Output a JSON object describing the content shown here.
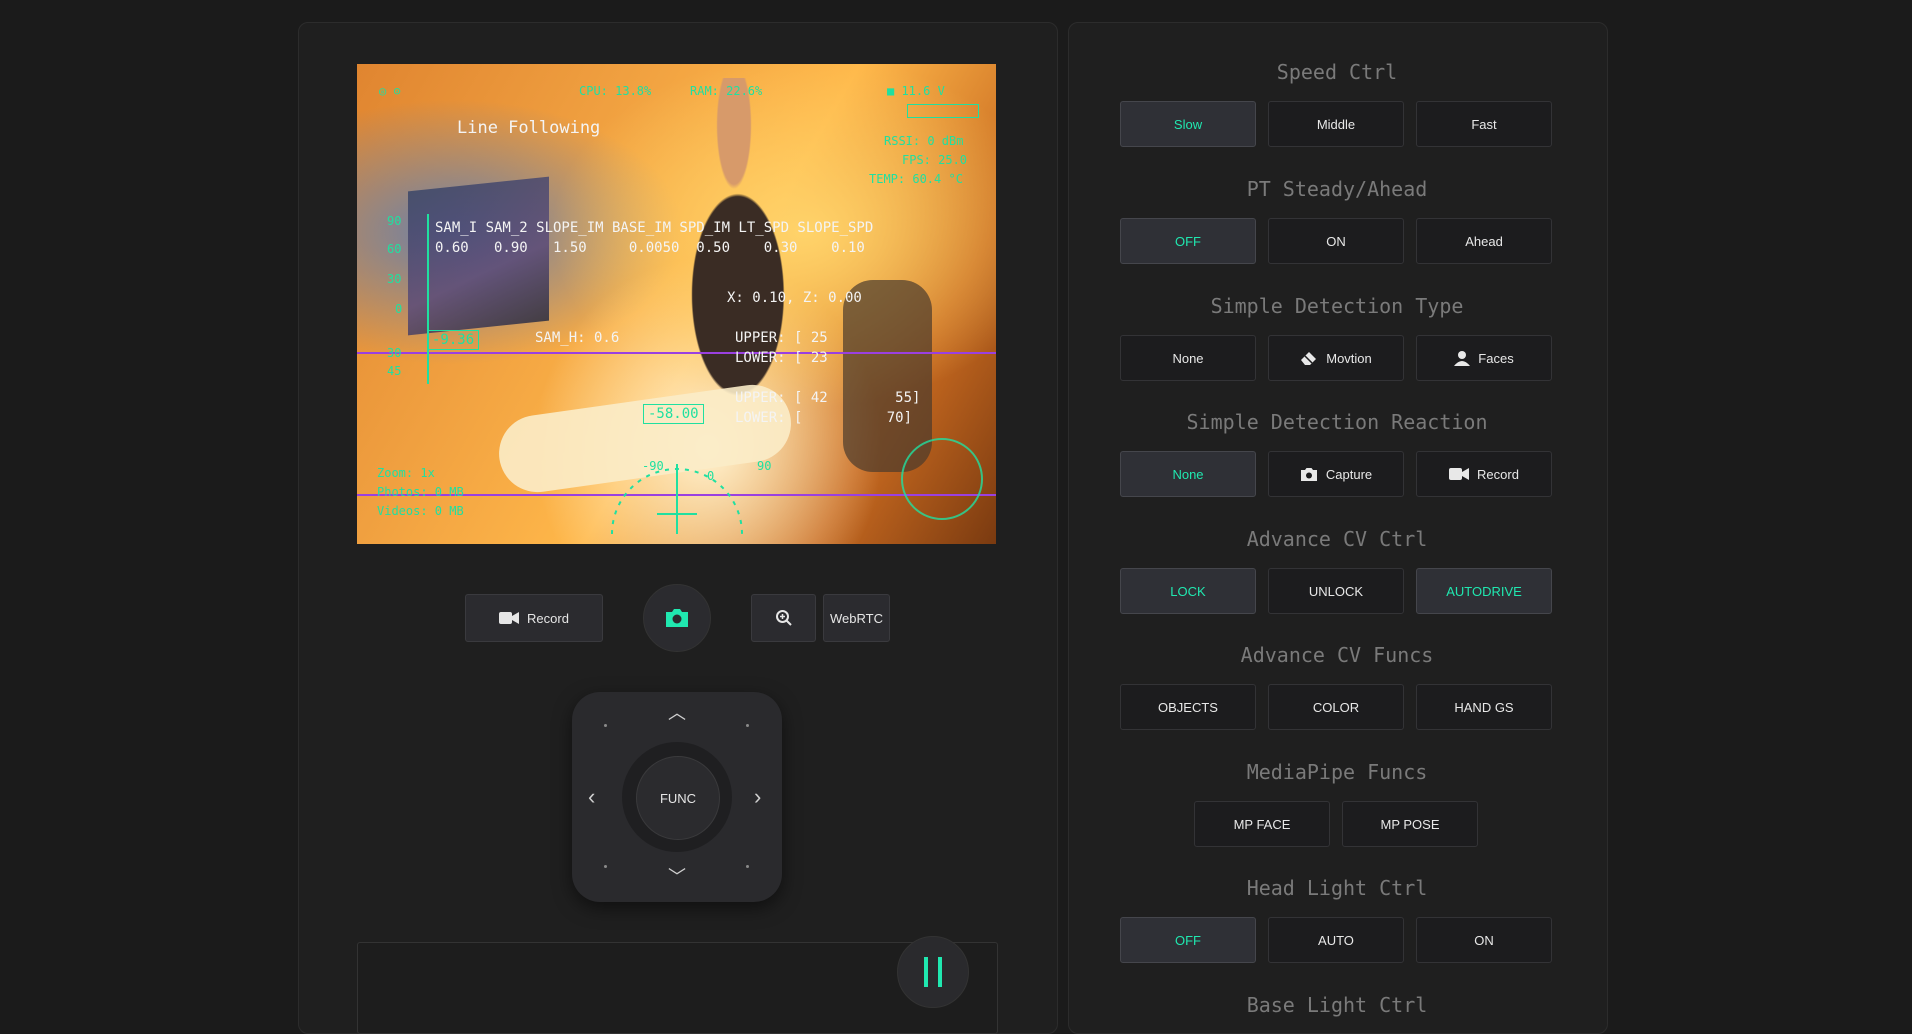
{
  "video": {
    "hud_top": {
      "cpu": "CPU: 13.8%",
      "ram": "RAM: 22.6%",
      "voltage": "■ 11.6 V"
    },
    "hud_right": {
      "rssi": "RSSI: 0 dBm",
      "fps": "FPS: 25.0",
      "temp": "TEMP: 60.4 °C"
    },
    "mode": "Line Following",
    "params_header": "SAM_I SAM_2 SLOPE_IM BASE_IM SPD_IM LT_SPD SLOPE_SPD",
    "params_values": "0.60   0.90   1.50     0.0050  0.50    0.30    0.10",
    "xz": "X: 0.10, Z: 0.00",
    "upper1": "UPPER: [ 25",
    "lower1": "LOWER: [ 23",
    "upper2": "UPPER: [ 42        55]",
    "lower2": "LOWER: [          70]",
    "sam_h": "SAM_H: 0.6",
    "pitch_value": "-9.36",
    "heading_value": "-58.00",
    "scale_labels": [
      "90",
      "60",
      "30",
      "0",
      "30",
      "45"
    ],
    "compass_labels": [
      "-90",
      "0",
      "90"
    ],
    "zoom": "Zoom: 1x",
    "photos": "Photos: 0 MB",
    "videos": "Videos: 0 MB"
  },
  "controls": {
    "record_label": "Record",
    "webrtc_label": "WebRTC",
    "func_label": "FUNC"
  },
  "sections": [
    {
      "title": "Speed Ctrl",
      "buttons": [
        {
          "label": "Slow",
          "active": true
        },
        {
          "label": "Middle"
        },
        {
          "label": "Fast"
        }
      ]
    },
    {
      "title": "PT Steady/Ahead",
      "buttons": [
        {
          "label": "OFF",
          "active": true
        },
        {
          "label": "ON"
        },
        {
          "label": "Ahead"
        }
      ]
    },
    {
      "title": "Simple Detection Type",
      "buttons": [
        {
          "label": "None"
        },
        {
          "label": "Movtion",
          "icon": "eraser-icon"
        },
        {
          "label": "Faces",
          "icon": "user-icon"
        }
      ]
    },
    {
      "title": "Simple Detection Reaction",
      "buttons": [
        {
          "label": "None",
          "active": true
        },
        {
          "label": "Capture",
          "icon": "camera-icon"
        },
        {
          "label": "Record",
          "icon": "video-camera-icon"
        }
      ]
    },
    {
      "title": "Advance CV Ctrl",
      "buttons": [
        {
          "label": "LOCK",
          "active": true
        },
        {
          "label": "UNLOCK"
        },
        {
          "label": "AUTODRIVE",
          "active": true
        }
      ]
    },
    {
      "title": "Advance CV Funcs",
      "buttons": [
        {
          "label": "OBJECTS"
        },
        {
          "label": "COLOR"
        },
        {
          "label": "HAND GS"
        }
      ]
    },
    {
      "title": "MediaPipe Funcs",
      "buttons": [
        {
          "label": "MP FACE"
        },
        {
          "label": "MP POSE"
        }
      ]
    },
    {
      "title": "Head Light Ctrl",
      "buttons": [
        {
          "label": "OFF",
          "active": true
        },
        {
          "label": "AUTO"
        },
        {
          "label": "ON"
        }
      ]
    },
    {
      "title": "Base Light Ctrl",
      "buttons": []
    }
  ],
  "colors": {
    "accent": "#20e8b0",
    "hud": "#20e0a0",
    "background": "#1b1b1b"
  }
}
